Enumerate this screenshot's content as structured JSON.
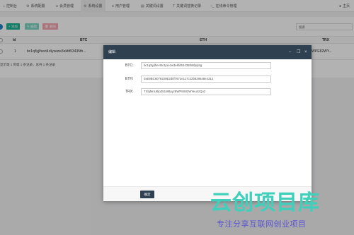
{
  "nav": {
    "tabs": [
      {
        "label": "控制台",
        "icon": "home-icon"
      },
      {
        "label": "系统配置",
        "icon": "gear-icon"
      },
      {
        "label": "会员管理",
        "icon": "user-icon"
      },
      {
        "label": "系统设置",
        "icon": "gear-icon"
      },
      {
        "label": "用户管理",
        "icon": "user-icon"
      },
      {
        "label": "关键词设置",
        "icon": "file-icon"
      },
      {
        "label": "关键词替换记录",
        "icon": "text-icon"
      },
      {
        "label": "在线命令管理",
        "icon": "terminal-icon"
      }
    ],
    "active_index": 3,
    "user_label": "主页"
  },
  "toolbar": {
    "add_label": "+ 添加",
    "edit_label": "✎ 编辑",
    "delete_label": "🗑 删除",
    "search_placeholder": "搜索"
  },
  "table": {
    "columns": [
      "Id",
      "BTC",
      "ETH",
      "TRX"
    ],
    "rows": [
      {
        "id": "1",
        "btc": "bc1q8yjlhevt4r4yxezw3ekfd53435th...",
        "eth": "",
        "trx": "...WPE82WY..."
      }
    ],
    "footer": "显示第 1 到第 1 条记录，总共 1 条记录"
  },
  "modal": {
    "title": "编辑",
    "fields": [
      {
        "label": "BTC:",
        "value": "bc1q8yjlhevt4r4yxezw3ekfd53435th8fpql4g"
      },
      {
        "label": "ETH:",
        "value": "0xE9BC6079229E2d0f7672e117c22b829648e4312"
      },
      {
        "label": "TRX:",
        "value": "TXbjMnU8ipZ51MByyz8WP6S82WYeu4zQo2"
      }
    ],
    "confirm_label": "确定"
  },
  "watermark": {
    "title": "云创项目库",
    "subtitle": "专注分享互联网创业项目"
  },
  "colors": {
    "primary_dark": "#2f4050",
    "add_green": "#1ab394",
    "edit_green": "#1ab394",
    "delete_red": "#ed5565"
  }
}
